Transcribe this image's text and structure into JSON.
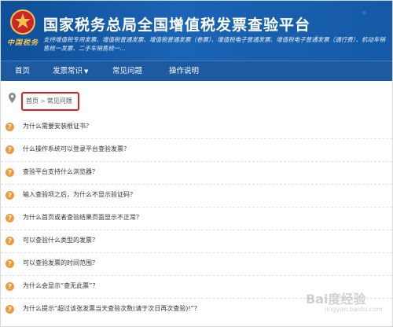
{
  "header": {
    "logo_script": "中国税务",
    "title": "国家税务总局全国增值税发票查验平台",
    "subtitle": "支持增值税专用发票、增值税普通发票、增值税普通发票（卷票）、增值税电子普通发票、增值税电子普通发票（通行费）、机动车销售统一发票、二手车销售统一..."
  },
  "nav": {
    "items": [
      {
        "label": "首页"
      },
      {
        "label": "发票常识"
      },
      {
        "label": "常见问题"
      },
      {
        "label": "操作说明"
      }
    ]
  },
  "breadcrumb": {
    "home": "首页",
    "separator": ">",
    "current": "常见问题"
  },
  "faq": {
    "icon_glyph": "?",
    "items": [
      {
        "question": "为什么需要安装根证书？"
      },
      {
        "question": "什么操作系统可以登录平台查验发票？"
      },
      {
        "question": "查验平台支持什么浏览器？"
      },
      {
        "question": "输入查验项之后，为什么不显示验证码？"
      },
      {
        "question": "为什么首页或者查验结果页面显示不正常？"
      },
      {
        "question": "可以查验什么类型的发票？"
      },
      {
        "question": "可以查验发票的时间范围？"
      },
      {
        "question": "为什么会显示“查无此票”？"
      },
      {
        "question": "为什么提示“超过该张发票当天查验次数(请于次日再次查验)!”？"
      }
    ]
  },
  "watermark": {
    "text": "Bai度经验",
    "sub": "jingyan.baidu.com"
  },
  "colors": {
    "header_blue": "#0d4f98",
    "nav_blue": "#1d5aa0",
    "highlight_red": "#e02020",
    "question_orange": "#ef9a3c"
  }
}
